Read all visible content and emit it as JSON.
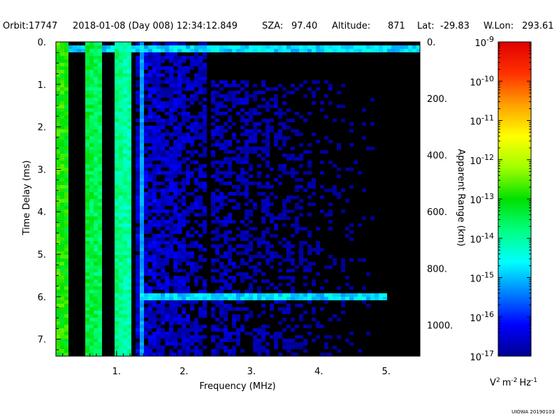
{
  "header": {
    "orbit": "Orbit:17747",
    "datetime": "2018-01-08 (Day 008) 12:34:12.849",
    "sza_label": "SZA:",
    "sza_value": "97.40",
    "altitude_label": "Altitude:",
    "altitude_value": "871",
    "lat_label": "Lat:",
    "lat_value": "-29.83",
    "wlon_label": "W.Lon:",
    "wlon_value": "293.61"
  },
  "credit": "UIOWA 20190103",
  "chart_data": {
    "type": "heatmap",
    "title": "",
    "xlabel": "Frequency (MHz)",
    "ylabel": "Time Delay (ms)",
    "y2label": "Apparent Range (km)",
    "xlim": [
      0.1,
      5.5
    ],
    "ylim": [
      7.4,
      0.0
    ],
    "x_ticks": [
      "1.",
      "2.",
      "3.",
      "4.",
      "5."
    ],
    "x_tick_values": [
      1,
      2,
      3,
      4,
      5
    ],
    "y_ticks": [
      "0.",
      "1.",
      "2.",
      "3.",
      "4.",
      "5.",
      "6.",
      "7."
    ],
    "y_tick_values": [
      0,
      1,
      2,
      3,
      4,
      5,
      6,
      7
    ],
    "y2_ticks": [
      "0.",
      "200.",
      "400.",
      "600.",
      "800.",
      "1000."
    ],
    "y2_tick_values": [
      0,
      200,
      400,
      600,
      800,
      1000
    ],
    "y2_per_ms": 150,
    "colorbar": {
      "scale": "log",
      "range": [
        1e-17,
        1e-09
      ],
      "labels": [
        {
          "base": "10",
          "exp": "-9"
        },
        {
          "base": "10",
          "exp": "-10"
        },
        {
          "base": "10",
          "exp": "-11"
        },
        {
          "base": "10",
          "exp": "-12"
        },
        {
          "base": "10",
          "exp": "-13"
        },
        {
          "base": "10",
          "exp": "-14"
        },
        {
          "base": "10",
          "exp": "-15"
        },
        {
          "base": "10",
          "exp": "-16"
        },
        {
          "base": "10",
          "exp": "-17"
        }
      ],
      "colors": [
        "#000090",
        "#0000ff",
        "#0080ff",
        "#00ffff",
        "#00ff80",
        "#00e000",
        "#a0ff00",
        "#ffff00",
        "#ffa000",
        "#ff3000",
        "#e00000"
      ],
      "unit": {
        "v": "V",
        "v_exp": "2",
        "m": "m",
        "m_exp": "-2",
        "hz": "Hz",
        "hz_exp": "-1"
      }
    },
    "features": [
      {
        "name": "",
        "kind": "horizontal-trace",
        "delay_ms": 0.2,
        "x_range": [
          0.1,
          5.5
        ],
        "level": -15
      },
      {
        "name": "",
        "kind": "horizontal-trace",
        "delay_ms": 5.97,
        "x_range": [
          1.35,
          5.0
        ],
        "level": -15
      },
      {
        "name": "",
        "kind": "vertical-dark-gap",
        "freq_mhz": 2.38
      },
      {
        "name": "",
        "kind": "vertical-bright-line",
        "freq_mhz": 1.35,
        "level": -15
      },
      {
        "name": "",
        "kind": "bright-low-frequency-band",
        "x_range": [
          0.1,
          1.3
        ],
        "level": -13
      }
    ]
  }
}
